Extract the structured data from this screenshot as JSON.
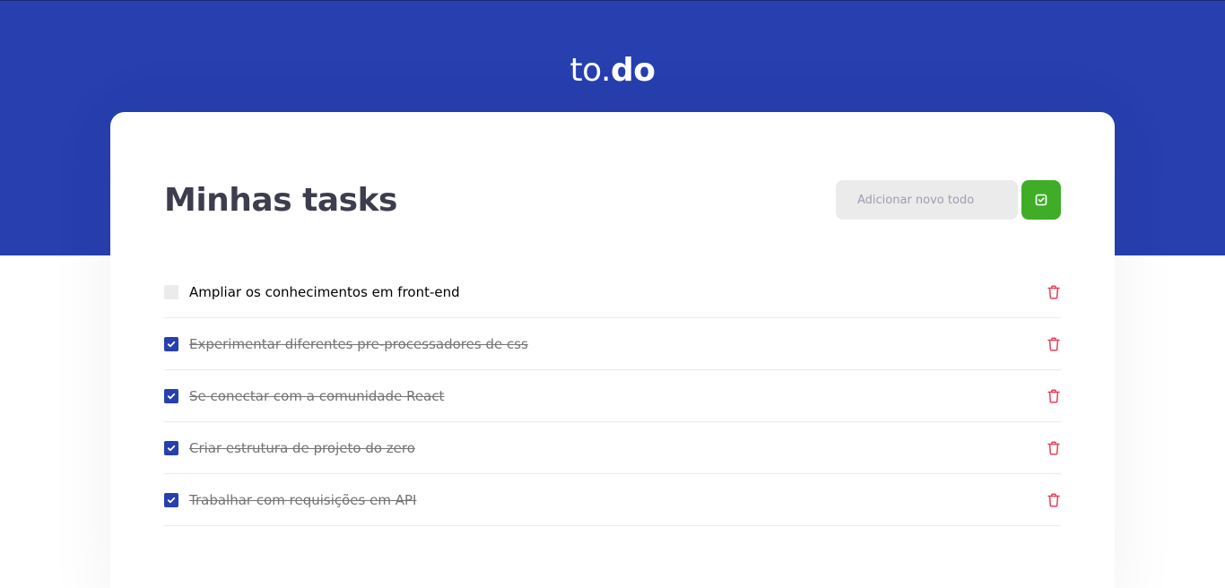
{
  "logo": {
    "light": "to.",
    "bold": "do"
  },
  "page_title": "Minhas tasks",
  "new_todo": {
    "placeholder": "Adicionar novo todo",
    "value": ""
  },
  "icons": {
    "add": "check-square-icon",
    "check": "check-icon",
    "delete": "trash-icon"
  },
  "colors": {
    "brand": "#273faf",
    "add_button": "#3fad27",
    "delete": "#e83f5b"
  },
  "tasks": [
    {
      "title": "Ampliar os conhecimentos em front-end",
      "done": false
    },
    {
      "title": "Experimentar diferentes pre-processadores de css",
      "done": true
    },
    {
      "title": "Se conectar com a comunidade React",
      "done": true
    },
    {
      "title": "Criar estrutura de projeto do zero",
      "done": true
    },
    {
      "title": "Trabalhar com requisições em API",
      "done": true
    }
  ]
}
